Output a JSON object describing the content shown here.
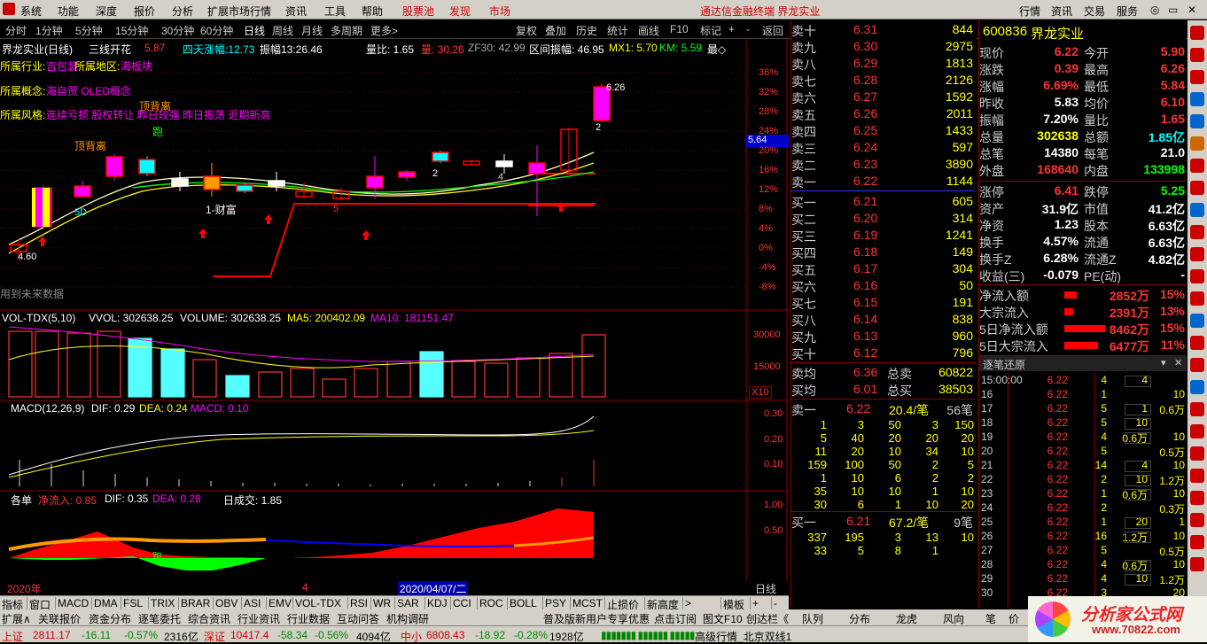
{
  "menu": {
    "items": [
      "系统",
      "功能",
      "深度",
      "报价",
      "分析",
      "扩展市场行情",
      "资讯",
      "工具",
      "帮助"
    ],
    "hot": [
      "股票池",
      "发现",
      "市场"
    ],
    "title": "通达信金融终端 界龙实业",
    "right": [
      "行情",
      "资讯",
      "交易",
      "服务"
    ]
  },
  "toolbar": {
    "periods": [
      "分时",
      "1分钟",
      "5分钟",
      "15分钟",
      "30分钟",
      "60分钟",
      "日线",
      "周线",
      "月线",
      "多周期",
      "更多>"
    ],
    "right": [
      "复权",
      "叠加",
      "历史",
      "统计",
      "画线",
      "F10",
      "标记",
      "+",
      "-",
      "返回"
    ]
  },
  "chart": {
    "header": {
      "name": "界龙实业(日线)",
      "indicator": "三线开花",
      "ind_val": "5.87",
      "line2": "四天涨幅:12.73",
      "line3": "振幅13:26.46",
      "quant": "量比: 1.65",
      "red1": "量: 30.26",
      "zf": "ZF30: 42.99",
      "qj": "区间振幅: 46.95",
      "mx": "MX1: 5.70",
      "km": "KM: 5.59",
      "more": "最◇"
    },
    "row1": "所属行业:",
    "row1v": "吉包装",
    "row1b": "所属地区:",
    "row1bv": "海板块",
    "row2": "所属概念:",
    "row2v": "海自贸 OLED概念",
    "row3": "所属风格:",
    "row3v": "连续亏损 股权转让 昨日较强 昨日振荡 近期新高",
    "note": "用到未来数据",
    "top_label": "6.26",
    "low_label": "4.60",
    "price_tag": "5.64",
    "labels": {
      "td1": "顶背离",
      "td2": "顶背离",
      "pao": "跑",
      "caifu": "1-财富",
      "n5a": "5",
      "n5b": "5D",
      "n2a": "2",
      "n2b": "2",
      "n4": "4"
    },
    "yaxis": [
      "36%",
      "32%",
      "28%",
      "24%",
      "20%",
      "16%",
      "12%",
      "8%",
      "4%",
      "0%",
      "-4%",
      "-8%"
    ],
    "vol_header": "VOL-TDX(5,10)",
    "vol_v": "VVOL: 302638.25",
    "vol_volume": "VOLUME: 302638.25",
    "vol_ma5": "MA5: 200402.09",
    "vol_ma10": "MA10: 181151.47",
    "vol_axis": [
      "30000",
      "15000",
      "X10"
    ],
    "macd_header": "MACD(12,26,9)",
    "macd_dif": "DIF: 0.29",
    "macd_dea": "DEA: 0.24",
    "macd_val": "MACD: 0.10",
    "macd_axis": [
      "0.30",
      "0.20",
      "0.10"
    ],
    "gd_header": "各单",
    "gd_net": "净流入: 0.85",
    "gd_dif": "DIF: 0.35",
    "gd_dea": "DEA: 0.28",
    "gd_cj": "日成交: 1.85",
    "gd_axis": [
      "1.00",
      "0.50"
    ],
    "x_left": "2020年",
    "x_mid": "4",
    "x_date": "2020/04/07/二",
    "x_right": "日线"
  },
  "chart_data": {
    "type": "line",
    "title": "界龙实业(日线)",
    "y_right": [
      "36%",
      "32%",
      "28%",
      "24%",
      "20%",
      "16%",
      "12%",
      "8%",
      "4%",
      "0%",
      "-4%",
      "-8%"
    ]
  },
  "indtabs": [
    "指标",
    "窗口",
    "MACD",
    "DMA",
    "FSL",
    "TRIX",
    "BRAR",
    "OBV",
    "ASI",
    "EMV",
    "VOL-TDX",
    "RSI",
    "WR",
    "SAR",
    "KDJ",
    "CCI",
    "ROC",
    "BOLL",
    "PSY",
    "MCST",
    "止损价",
    "新高度",
    ">",
    "模板",
    "+",
    "-"
  ],
  "btabs": [
    "扩展∧",
    "关联报价",
    "资金分布",
    "逐笔委托",
    "综合资讯",
    "行业资讯",
    "行业数据",
    "互动问答",
    "机构调研",
    "普及版新用户专享优惠",
    "点击订阅",
    "图文F10",
    "创达栏《",
    "队列",
    "分布",
    "龙虎",
    "风向",
    "笔",
    "价"
  ],
  "quote": {
    "sells": [
      [
        "卖十",
        "6.31",
        "844"
      ],
      [
        "卖九",
        "6.30",
        "2975"
      ],
      [
        "卖八",
        "6.29",
        "1813"
      ],
      [
        "卖七",
        "6.28",
        "2126"
      ],
      [
        "卖六",
        "6.27",
        "1592"
      ],
      [
        "卖五",
        "6.26",
        "2011"
      ],
      [
        "卖四",
        "6.25",
        "1433"
      ],
      [
        "卖三",
        "6.24",
        "597"
      ],
      [
        "卖二",
        "6.23",
        "3890"
      ],
      [
        "卖一",
        "6.22",
        "1144"
      ]
    ],
    "buys": [
      [
        "买一",
        "6.21",
        "605"
      ],
      [
        "买二",
        "6.20",
        "314"
      ],
      [
        "买三",
        "6.19",
        "1241"
      ],
      [
        "买四",
        "6.18",
        "149"
      ],
      [
        "买五",
        "6.17",
        "304"
      ],
      [
        "买六",
        "6.16",
        "50"
      ],
      [
        "买七",
        "6.15",
        "191"
      ],
      [
        "买八",
        "6.14",
        "838"
      ],
      [
        "买九",
        "6.13",
        "960"
      ],
      [
        "买十",
        "6.12",
        "796"
      ]
    ],
    "avg1": [
      "卖均",
      "6.36",
      "总卖",
      "60822"
    ],
    "avg2": [
      "买均",
      "6.01",
      "总买",
      "38503"
    ],
    "q1": [
      "卖一",
      "6.22",
      "20.4/笔",
      "56笔"
    ],
    "q1rows": [
      [
        "1",
        "3",
        "50",
        "3",
        "150"
      ],
      [
        "5",
        "40",
        "20",
        "20",
        "20"
      ],
      [
        "11",
        "20",
        "10",
        "34",
        "10"
      ],
      [
        "159",
        "100",
        "50",
        "2",
        "5"
      ],
      [
        "1",
        "10",
        "6",
        "2",
        "2"
      ],
      [
        "35",
        "10",
        "10",
        "1",
        "10"
      ],
      [
        "30",
        "6",
        "1",
        "10",
        "20"
      ]
    ],
    "q2": [
      "买一",
      "6.21",
      "67.2/笔",
      "9笔"
    ],
    "q2rows": [
      [
        "337",
        "195",
        "3",
        "13",
        "10"
      ],
      [
        "33",
        "5",
        "8",
        "1",
        ""
      ]
    ]
  },
  "info": {
    "code": "600836",
    "name": "界龙实业",
    "rows": [
      [
        "现价",
        "6.22",
        "今开",
        "5.90"
      ],
      [
        "涨跌",
        "0.39",
        "最高",
        "6.26"
      ],
      [
        "涨幅",
        "6.69%",
        "最低",
        "5.84"
      ],
      [
        "昨收",
        "5.83",
        "均价",
        "6.10"
      ],
      [
        "振幅",
        "7.20%",
        "量比",
        "1.65"
      ],
      [
        "总量",
        "302638",
        "总额",
        "1.85亿"
      ],
      [
        "总笔",
        "14380",
        "每笔",
        "21.0"
      ],
      [
        "外盘",
        "168640",
        "内盘",
        "133998"
      ]
    ],
    "rows2": [
      [
        "涨停",
        "6.41",
        "跌停",
        "5.25"
      ],
      [
        "资产",
        "31.9亿",
        "市值",
        "41.2亿"
      ],
      [
        "净资",
        "1.23",
        "股本",
        "6.63亿"
      ],
      [
        "换手",
        "4.57%",
        "流通",
        "6.63亿"
      ],
      [
        "换手Z",
        "6.28%",
        "流通Z",
        "4.82亿"
      ],
      [
        "收益(三)",
        "-0.079",
        "PE(动)",
        "-"
      ]
    ],
    "flows": [
      [
        "净流入额",
        "2852万",
        "15%"
      ],
      [
        "大宗流入",
        "2391万",
        "13%"
      ],
      [
        "5日净流入额",
        "8462万",
        "15%"
      ],
      [
        "5日大宗流入",
        "6477万",
        "11%"
      ]
    ],
    "ticks_title": "逐笔还原",
    "ticks": [
      [
        "15:00:00",
        "6.22",
        "4",
        "4",
        ""
      ],
      [
        "16",
        "6.22",
        "1",
        "",
        "10"
      ],
      [
        "17",
        "6.22",
        "5",
        "1",
        "0.6万"
      ],
      [
        "18",
        "6.22",
        "5",
        "10",
        ""
      ],
      [
        "19",
        "6.22",
        "4",
        "0.6万",
        "10"
      ],
      [
        "20",
        "6.22",
        "5",
        "",
        "0.5万"
      ],
      [
        "21",
        "6.22",
        "14",
        "4",
        "10"
      ],
      [
        "22",
        "6.22",
        "2",
        "10",
        "1.2万"
      ],
      [
        "23",
        "6.22",
        "1",
        "0.6万",
        "10"
      ],
      [
        "24",
        "6.22",
        "2",
        "",
        "0.3万"
      ],
      [
        "25",
        "6.22",
        "1",
        "20",
        "1"
      ],
      [
        "26",
        "6.22",
        "16",
        "1.2万",
        "10"
      ],
      [
        "27",
        "6.22",
        "5",
        "",
        "0.5万"
      ],
      [
        "28",
        "6.22",
        "4",
        "0.6万",
        "10"
      ],
      [
        "29",
        "6.22",
        "4",
        "10",
        "1.2万"
      ],
      [
        "30",
        "6.22",
        "3",
        "",
        "20"
      ]
    ]
  },
  "status": {
    "sh": "上证",
    "sh_v": "2811.17",
    "sh_c": "-16.11",
    "sh_p": "-0.57%",
    "sh_a": "2316亿",
    "sz": "深证",
    "sz_v": "10417.4",
    "sz_c": "-58.34",
    "sz_p": "-0.56%",
    "sz_a": "4094亿",
    "zx": "中小",
    "zx_v": "6808.43",
    "zx_c": "-18.92",
    "zx_p": "-0.28%",
    "zx_a": "1928亿",
    "hq": "高级行情_北京双线1"
  },
  "logo": {
    "text": "分析家公式网",
    "url": "www.70822.com"
  }
}
